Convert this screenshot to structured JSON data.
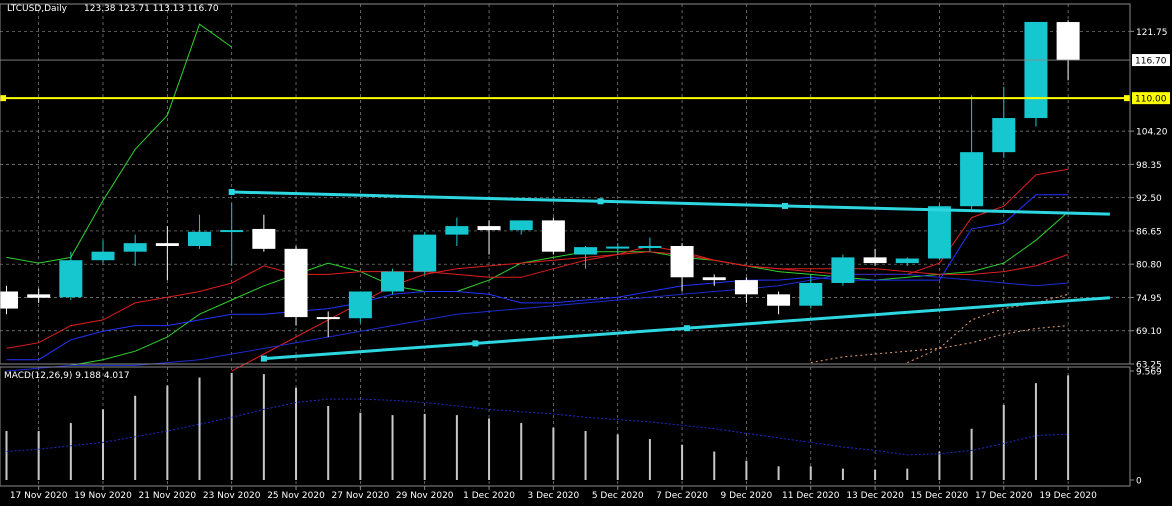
{
  "header": {
    "symbol": "LTCUSD,Daily",
    "ohlc": "123.38 123.71 113.13 116.70"
  },
  "macd_header": "MACD(12,26,9) 9.188 4.017",
  "colors": {
    "background": "#000000",
    "grid": "#8a8a8a",
    "bull": "#17c7cf",
    "bear": "#ffffff",
    "horizontal_line": "#ffff00",
    "trendline": "#2ed6e0",
    "price_tag": "#ffffff"
  },
  "chart_data": [
    {
      "type": "candlestick",
      "name": "LTCUSD,Daily",
      "ylim": [
        63.25,
        125.5
      ],
      "yticks": [
        "121.75",
        "116.70",
        "110.00",
        "104.20",
        "98.35",
        "92.50",
        "86.65",
        "80.80",
        "74.95",
        "69.10",
        "63.25"
      ],
      "current_price": "116.70",
      "horizontal_level": "110.00",
      "xticks": [
        "17 Nov 2020",
        "19 Nov 2020",
        "21 Nov 2020",
        "23 Nov 2020",
        "25 Nov 2020",
        "27 Nov 2020",
        "29 Nov 2020",
        "1 Dec 2020",
        "3 Dec 2020",
        "5 Dec 2020",
        "7 Dec 2020",
        "9 Dec 2020",
        "11 Dec 2020",
        "13 Dec 2020",
        "15 Dec 2020",
        "17 Dec 2020",
        "19 Dec 2020"
      ],
      "candles": [
        {
          "date": "16 Nov",
          "o": 76.0,
          "h": 77.0,
          "l": 72.0,
          "c": 73.0
        },
        {
          "date": "17 Nov",
          "o": 75.5,
          "h": 76.5,
          "l": 74.0,
          "c": 74.9
        },
        {
          "date": "18 Nov",
          "o": 75.0,
          "h": 83.0,
          "l": 74.5,
          "c": 81.5
        },
        {
          "date": "19 Nov",
          "o": 81.5,
          "h": 85.0,
          "l": 81.0,
          "c": 83.0
        },
        {
          "date": "20 Nov",
          "o": 83.0,
          "h": 86.0,
          "l": 80.5,
          "c": 84.5
        },
        {
          "date": "21 Nov",
          "o": 84.5,
          "h": 87.5,
          "l": 78.0,
          "c": 84.0
        },
        {
          "date": "22 Nov",
          "o": 84.0,
          "h": 89.5,
          "l": 83.5,
          "c": 86.5
        },
        {
          "date": "23 Nov",
          "o": 86.5,
          "h": 91.5,
          "l": 80.5,
          "c": 86.8
        },
        {
          "date": "24 Nov",
          "o": 87.0,
          "h": 89.5,
          "l": 83.0,
          "c": 83.5
        },
        {
          "date": "25 Nov",
          "o": 83.5,
          "h": 84.0,
          "l": 70.0,
          "c": 71.5
        },
        {
          "date": "26 Nov",
          "o": 71.5,
          "h": 72.5,
          "l": 68.0,
          "c": 71.3
        },
        {
          "date": "27 Nov",
          "o": 71.3,
          "h": 76.0,
          "l": 70.5,
          "c": 76.0
        },
        {
          "date": "28 Nov",
          "o": 76.0,
          "h": 80.0,
          "l": 75.5,
          "c": 79.5
        },
        {
          "date": "29 Nov",
          "o": 79.5,
          "h": 86.5,
          "l": 79.0,
          "c": 86.0
        },
        {
          "date": "30 Nov",
          "o": 86.0,
          "h": 89.0,
          "l": 84.0,
          "c": 87.5
        },
        {
          "date": "1 Dec",
          "o": 87.5,
          "h": 88.5,
          "l": 82.5,
          "c": 86.8
        },
        {
          "date": "2 Dec",
          "o": 86.8,
          "h": 88.5,
          "l": 86.0,
          "c": 88.5
        },
        {
          "date": "3 Dec",
          "o": 88.5,
          "h": 89.0,
          "l": 82.5,
          "c": 83.0
        },
        {
          "date": "4 Dec",
          "o": 82.5,
          "h": 84.0,
          "l": 80.0,
          "c": 83.8
        },
        {
          "date": "5 Dec",
          "o": 83.8,
          "h": 84.5,
          "l": 82.5,
          "c": 83.9
        },
        {
          "date": "6 Dec",
          "o": 83.9,
          "h": 85.5,
          "l": 83.0,
          "c": 84.0
        },
        {
          "date": "7 Dec",
          "o": 84.0,
          "h": 84.5,
          "l": 76.0,
          "c": 78.5
        },
        {
          "date": "8 Dec",
          "o": 78.5,
          "h": 79.0,
          "l": 77.0,
          "c": 78.0
        },
        {
          "date": "9 Dec",
          "o": 78.0,
          "h": 78.5,
          "l": 74.0,
          "c": 75.5
        },
        {
          "date": "10 Dec",
          "o": 75.5,
          "h": 76.0,
          "l": 72.0,
          "c": 73.5
        },
        {
          "date": "11 Dec",
          "o": 73.5,
          "h": 79.0,
          "l": 73.0,
          "c": 77.5
        },
        {
          "date": "12 Dec",
          "o": 77.5,
          "h": 82.5,
          "l": 77.0,
          "c": 82.0
        },
        {
          "date": "13 Dec",
          "o": 82.0,
          "h": 83.5,
          "l": 80.5,
          "c": 81.0
        },
        {
          "date": "14 Dec",
          "o": 81.0,
          "h": 82.0,
          "l": 80.5,
          "c": 81.8
        },
        {
          "date": "15 Dec",
          "o": 81.8,
          "h": 91.5,
          "l": 81.5,
          "c": 91.0
        },
        {
          "date": "16 Dec",
          "o": 91.0,
          "h": 110.5,
          "l": 90.5,
          "c": 100.5
        },
        {
          "date": "17 Dec",
          "o": 100.5,
          "h": 112.0,
          "l": 99.5,
          "c": 106.5
        },
        {
          "date": "18 Dec",
          "o": 106.5,
          "h": 123.0,
          "l": 105.0,
          "c": 123.4
        },
        {
          "date": "19 Dec",
          "o": 123.38,
          "h": 123.71,
          "l": 113.13,
          "c": 116.7
        }
      ],
      "trendlines": [
        {
          "name": "upper",
          "points": [
            [
              7,
              93.5
            ],
            [
              34.3,
              89.6
            ]
          ]
        },
        {
          "name": "lower",
          "points": [
            [
              8,
              64.2
            ],
            [
              34.3,
              74.9
            ]
          ]
        }
      ],
      "indicators": [
        {
          "name": "green",
          "color": "#2fd02f",
          "values": [
            82.0,
            81.0,
            82.0,
            92.0,
            101.0,
            107.0,
            123.0,
            119.0,
            null,
            null,
            null,
            null,
            null,
            null,
            null,
            null,
            null,
            null,
            null,
            null,
            null,
            null,
            null,
            null,
            null,
            null,
            null,
            null,
            null,
            null,
            null,
            null,
            null,
            null
          ]
        },
        {
          "name": "green-slow",
          "color": "#2fd02f",
          "values": [
            null,
            null,
            63.0,
            64.0,
            65.5,
            68.0,
            72.0,
            74.5,
            77.0,
            79.0,
            81.0,
            79.5,
            77.0,
            76.0,
            76.0,
            78.0,
            81.0,
            82.0,
            83.0,
            83.0,
            83.0,
            82.0,
            81.5,
            80.5,
            79.5,
            79.0,
            78.5,
            78.0,
            78.5,
            79.0,
            79.5,
            81.0,
            85.0,
            90.0
          ]
        },
        {
          "name": "red",
          "color": "#e01e1e",
          "values": [
            66.0,
            67.0,
            70.0,
            71.0,
            74.0,
            75.0,
            76.0,
            77.5,
            80.5,
            79.0,
            79.0,
            79.5,
            79.5,
            79.5,
            79.0,
            78.5,
            78.5,
            80.0,
            81.5,
            82.5,
            84.0,
            83.0,
            81.5,
            80.5,
            80.0,
            80.0,
            80.0,
            80.0,
            79.5,
            79.0,
            79.0,
            79.5,
            80.5,
            82.5
          ]
        },
        {
          "name": "red-short",
          "color": "#e01e1e",
          "values": [
            null,
            null,
            null,
            null,
            null,
            null,
            null,
            62.0,
            65.0,
            68.0,
            71.0,
            74.0,
            77.0,
            79.0,
            80.0,
            80.5,
            81.0,
            81.5,
            82.0,
            82.5,
            83.0,
            82.5,
            81.5,
            80.5,
            80.0,
            79.5,
            79.0,
            79.0,
            79.0,
            81.0,
            89.0,
            91.0,
            96.5,
            97.5
          ]
        },
        {
          "name": "blue",
          "color": "#2233ff",
          "values": [
            64.0,
            64.0,
            67.5,
            69.0,
            70.0,
            70.0,
            71.0,
            72.0,
            72.0,
            72.5,
            73.0,
            74.0,
            75.5,
            76.0,
            76.0,
            75.5,
            74.0,
            74.0,
            74.5,
            75.0,
            76.0,
            77.0,
            77.5,
            78.0,
            78.0,
            78.5,
            78.0,
            78.0,
            78.0,
            78.0,
            87.0,
            88.0,
            93.0,
            93.0
          ]
        },
        {
          "name": "blue-long",
          "color": "#1c2bd0",
          "values": [
            62.0,
            62.5,
            63.0,
            63.0,
            63.0,
            63.5,
            64.0,
            65.0,
            66.0,
            67.0,
            68.0,
            69.0,
            70.0,
            71.0,
            72.0,
            72.5,
            73.0,
            73.5,
            74.0,
            74.5,
            75.0,
            75.5,
            76.0,
            76.5,
            77.0,
            78.0,
            79.0,
            79.0,
            79.0,
            78.5,
            78.0,
            77.5,
            77.0,
            77.5
          ]
        },
        {
          "name": "orange-dotted-1",
          "color": "#e8a070",
          "dashed": true,
          "values": [
            null,
            null,
            null,
            null,
            null,
            null,
            null,
            null,
            null,
            null,
            null,
            null,
            null,
            null,
            null,
            null,
            null,
            null,
            null,
            null,
            null,
            null,
            null,
            null,
            null,
            63.5,
            64.5,
            65.0,
            65.5,
            66.0,
            67.0,
            68.5,
            69.5,
            70.0
          ]
        },
        {
          "name": "orange-dotted-2",
          "color": "#e8a070",
          "dashed": true,
          "values": [
            null,
            null,
            null,
            null,
            null,
            null,
            null,
            null,
            null,
            null,
            null,
            null,
            null,
            null,
            null,
            null,
            null,
            null,
            null,
            null,
            null,
            null,
            null,
            null,
            null,
            null,
            null,
            null,
            63.5,
            66.0,
            71.0,
            73.0,
            74.0,
            75.5
          ]
        }
      ]
    },
    {
      "type": "bar",
      "name": "MACD(12,26,9)",
      "ylim": [
        0,
        9.569
      ],
      "yticks": [
        "9.569",
        "0"
      ],
      "values": [
        4.3,
        4.3,
        5.0,
        6.2,
        7.4,
        8.3,
        9.0,
        9.4,
        9.3,
        8.1,
        6.5,
        5.9,
        5.7,
        5.8,
        5.7,
        5.4,
        5.0,
        4.6,
        4.3,
        4.0,
        3.6,
        3.1,
        2.5,
        1.7,
        1.2,
        1.2,
        1.0,
        0.9,
        1.0,
        2.5,
        4.5,
        6.6,
        8.5,
        9.188
      ],
      "signal": [
        2.5,
        2.7,
        3.0,
        3.3,
        3.8,
        4.3,
        4.9,
        5.5,
        6.2,
        6.8,
        7.1,
        7.1,
        7.0,
        6.8,
        6.5,
        6.2,
        6.0,
        5.8,
        5.5,
        5.3,
        5.1,
        4.8,
        4.5,
        4.1,
        3.7,
        3.3,
        2.9,
        2.6,
        2.2,
        2.3,
        2.6,
        3.2,
        3.9,
        4.017
      ]
    }
  ]
}
